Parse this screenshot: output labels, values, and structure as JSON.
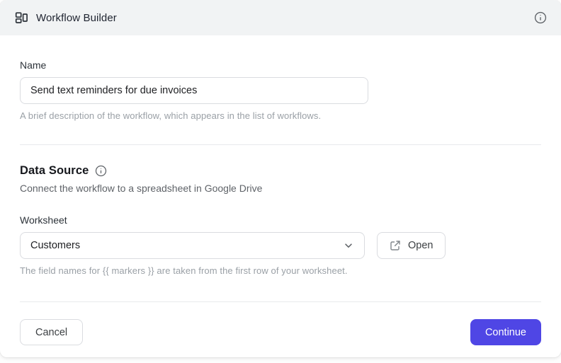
{
  "header": {
    "title": "Workflow Builder",
    "icon": "workflow-icon",
    "info_icon": "info-icon"
  },
  "name_section": {
    "label": "Name",
    "value": "Send text reminders for due invoices",
    "helper": "A brief description of the workflow, which appears in the list of workflows."
  },
  "data_source_section": {
    "title": "Data Source",
    "info_icon": "info-icon",
    "subtitle": "Connect the workflow to a spreadsheet in Google Drive",
    "worksheet_label": "Worksheet",
    "worksheet_value": "Customers",
    "worksheet_dropdown_icon": "chevron-down-icon",
    "open_button": {
      "label": "Open",
      "icon": "external-link-icon"
    },
    "helper": "The field names for {{ markers }} are taken from the first row of your worksheet."
  },
  "footer": {
    "cancel_label": "Cancel",
    "continue_label": "Continue"
  },
  "colors": {
    "accent": "#4f46e5",
    "header_bg": "#f1f3f4",
    "border": "#dadce0",
    "text_dark": "#202124",
    "text_mid": "#5f6368",
    "text_light": "#9aa0a6"
  }
}
